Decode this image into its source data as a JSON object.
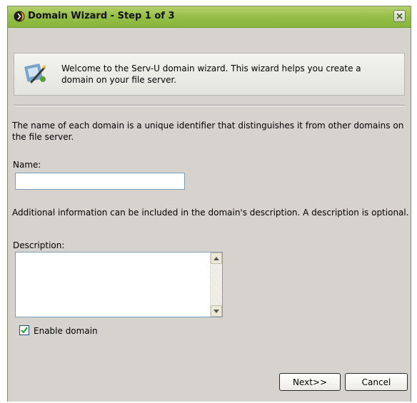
{
  "window": {
    "title": "Domain Wizard - Step 1 of 3"
  },
  "welcome": {
    "text": "Welcome to the Serv-U domain wizard. This wizard helps you create a domain on your file server."
  },
  "form": {
    "name_intro": "The name of each domain is a unique identifier that distinguishes it from other domains on the file server.",
    "name_label": "Name:",
    "name_value": "",
    "description_intro": "Additional information can be included in the domain's description. A description is optional.",
    "description_label": "Description:",
    "description_value": "",
    "enable_label": "Enable domain",
    "enable_checked": true
  },
  "buttons": {
    "next_label": "Next>>",
    "cancel_label": "Cancel"
  },
  "colors": {
    "titlebar": "#98c04a",
    "dialog_bg": "#d6d3ce",
    "check": "#21a121"
  }
}
